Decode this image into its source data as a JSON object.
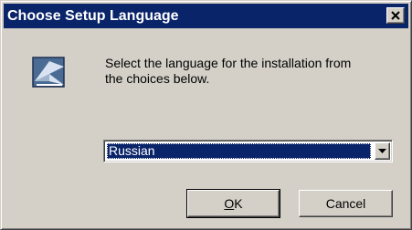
{
  "window": {
    "title": "Choose Setup Language",
    "close_label": "×"
  },
  "dialog": {
    "message_line1": "Select the language for the installation from",
    "message_line2": "the choices below.",
    "icon": "setup-installer-icon"
  },
  "language_select": {
    "selected": "Russian",
    "arrow_icon": "chevron-down-icon"
  },
  "buttons": {
    "ok_mnemonic": "O",
    "ok_rest": "K",
    "cancel_label": "Cancel"
  },
  "colors": {
    "titlebar": "#0a246a",
    "face": "#d4d0c8",
    "selection": "#0a246a"
  }
}
